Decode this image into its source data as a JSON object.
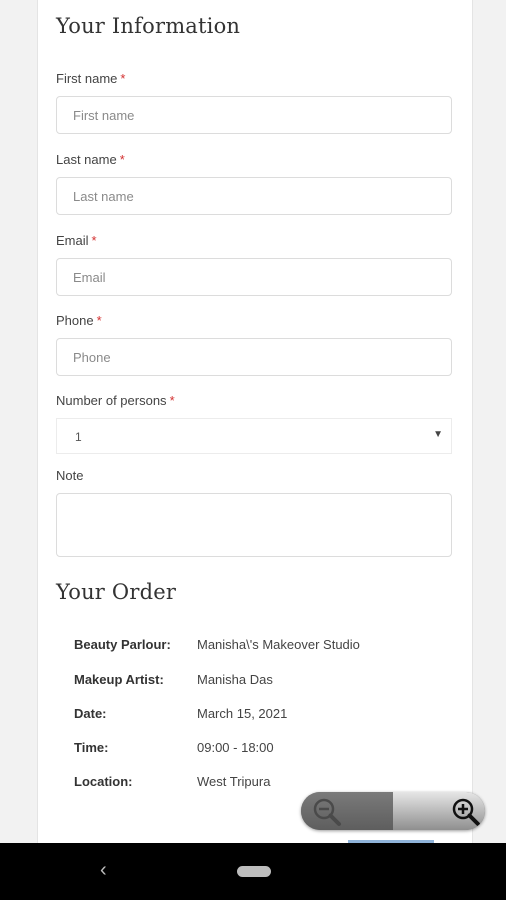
{
  "info": {
    "title": "Your Information",
    "first_name": {
      "label": "First name",
      "required": "*",
      "placeholder": "First name"
    },
    "last_name": {
      "label": "Last name",
      "required": "*",
      "placeholder": "Last name"
    },
    "email": {
      "label": "Email",
      "required": "*",
      "placeholder": "Email"
    },
    "phone": {
      "label": "Phone",
      "required": "*",
      "placeholder": "Phone"
    },
    "persons": {
      "label": "Number of persons",
      "required": "*",
      "value": "1",
      "arrow": "▼"
    },
    "note": {
      "label": "Note"
    }
  },
  "order": {
    "title": "Your Order",
    "rows": [
      {
        "key": "Beauty Parlour:",
        "value": "Manisha\\'s Makeover Studio"
      },
      {
        "key": "Makeup Artist:",
        "value": "Manisha Das"
      },
      {
        "key": "Date:",
        "value": "March 15, 2021"
      },
      {
        "key": "Time:",
        "value": "09:00 - 18:00"
      },
      {
        "key": "Location:",
        "value": "West Tripura"
      }
    ]
  },
  "zoom": {
    "out_icon": "zoom-out-icon",
    "in_icon": "zoom-in-icon"
  },
  "nav": {
    "back_glyph": "‹",
    "back_icon": "back-icon",
    "home_icon": "home-pill-icon"
  },
  "colors": {
    "required": "#d32f2f",
    "background": "#f2f2f2",
    "panel": "#ffffff",
    "navbar": "#000000"
  }
}
